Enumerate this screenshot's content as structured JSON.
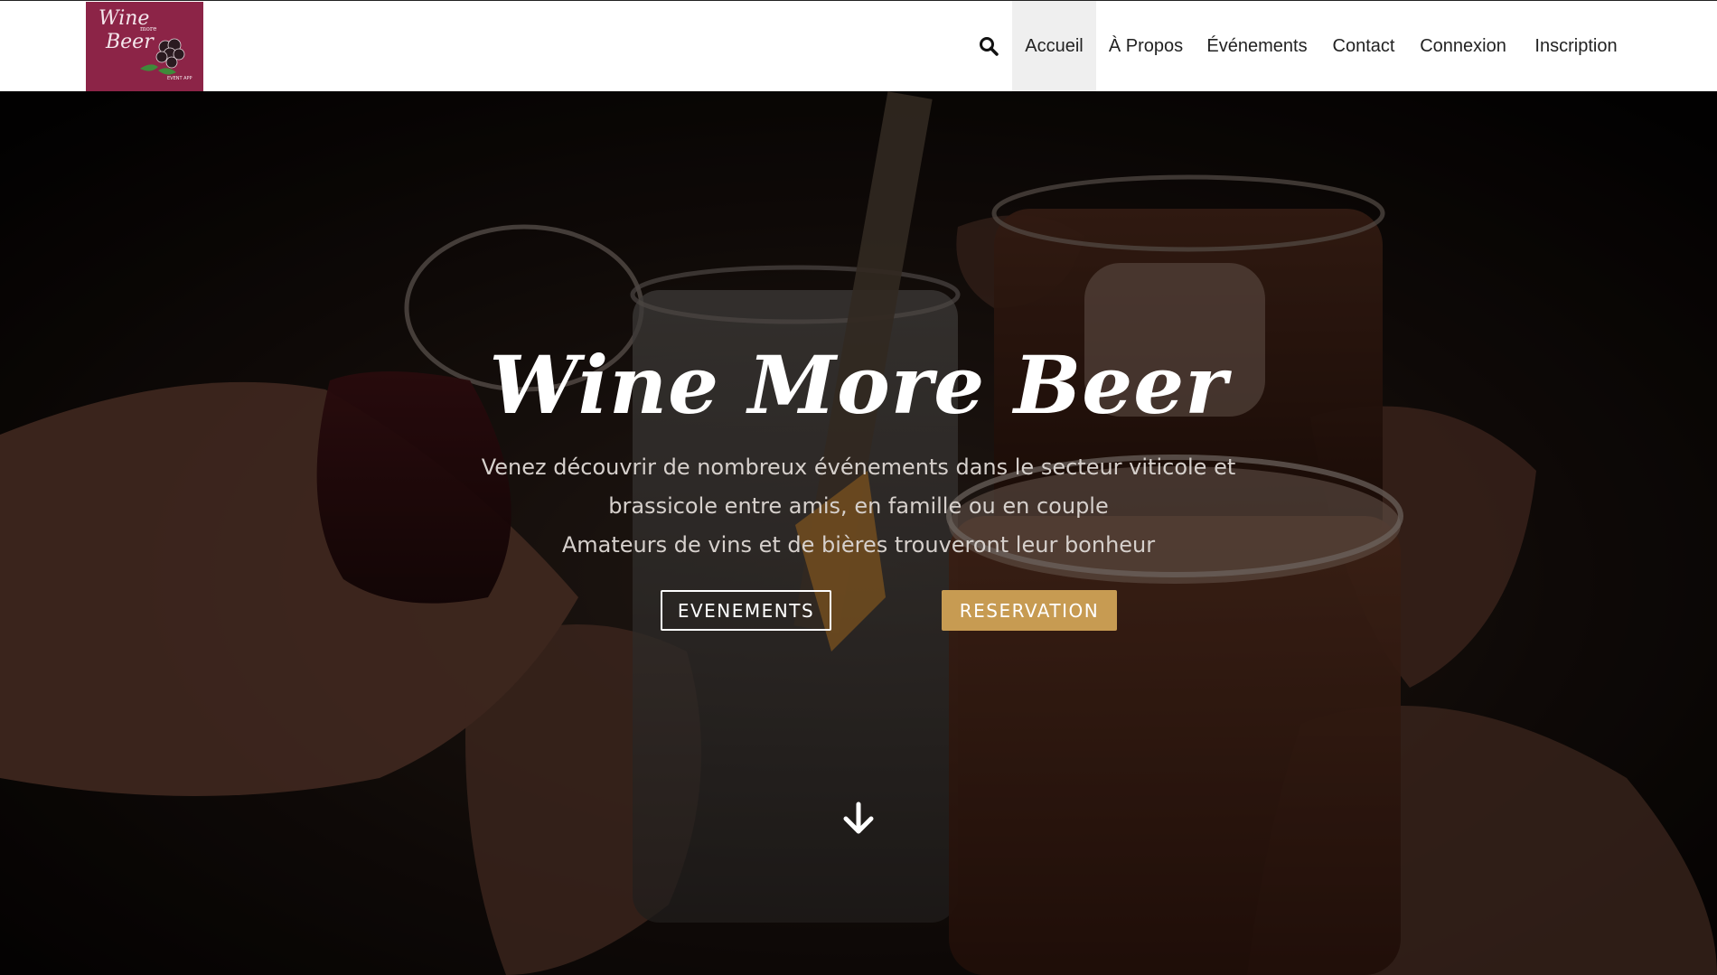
{
  "header": {
    "logo": {
      "text_line1": "Wine",
      "text_line2": "more",
      "text_line3": "Beer",
      "small_text": "EVENT APP"
    },
    "search_icon": "search-icon",
    "nav_items": [
      {
        "label": "Accueil",
        "active": true
      },
      {
        "label": "À Propos",
        "active": false
      },
      {
        "label": "Événements",
        "active": false
      },
      {
        "label": "Contact",
        "active": false
      },
      {
        "label": "Connexion",
        "active": false
      },
      {
        "label": "Inscription",
        "active": false
      }
    ]
  },
  "hero": {
    "title": "Wine More Beer",
    "subtitle_line1": "Venez découvrir de nombreux événements dans le secteur viticole et",
    "subtitle_line2": "brassicole entre amis, en famille ou en couple",
    "subtitle_line3": "Amateurs de vins et de bières trouveront leur bonheur",
    "buttons": {
      "events": "EVENEMENTS",
      "reservation": "RESERVATION"
    },
    "scroll_icon": "arrow-down-icon"
  },
  "colors": {
    "logo_bg": "#8c2447",
    "accent_gold": "#c79b52",
    "nav_active_bg": "#efefef"
  }
}
